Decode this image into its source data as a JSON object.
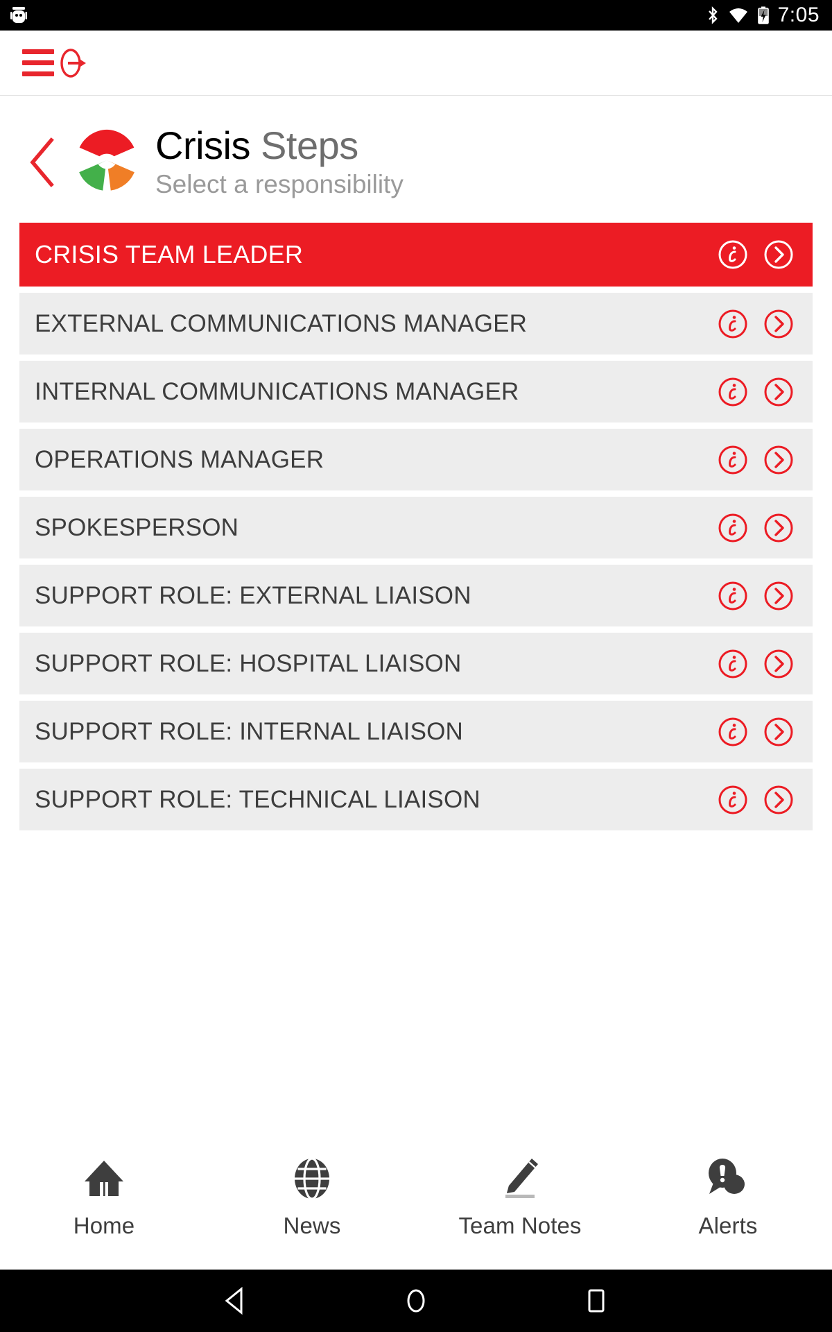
{
  "status_bar": {
    "time": "7:05",
    "icons": [
      "android-robot-icon",
      "bluetooth-icon",
      "wifi-icon",
      "battery-charging-icon"
    ]
  },
  "app_bar": {
    "menu_icon": "hamburger-menu-icon",
    "logout_icon": "logout-icon"
  },
  "header": {
    "back_icon": "back-chevron-icon",
    "logo_icon": "crisis-steps-logo",
    "title_primary": "Crisis",
    "title_secondary": "Steps",
    "subtitle": "Select a responsibility"
  },
  "colors": {
    "brand_red": "#ec1c24",
    "row_gray": "#ededed",
    "row_text": "#3d3d3d",
    "logo_green": "#43b04a",
    "logo_orange": "#f07e26",
    "title_secondary": "#6e6e6e",
    "subtitle": "#9a9a9a"
  },
  "roles": [
    {
      "label": "CRISIS TEAM LEADER",
      "selected": true,
      "info_icon": "info-circle-icon",
      "chevron_icon": "chevron-right-circle-icon"
    },
    {
      "label": "EXTERNAL COMMUNICATIONS MANAGER",
      "selected": false,
      "info_icon": "info-circle-icon",
      "chevron_icon": "chevron-right-circle-icon"
    },
    {
      "label": "INTERNAL COMMUNICATIONS MANAGER",
      "selected": false,
      "info_icon": "info-circle-icon",
      "chevron_icon": "chevron-right-circle-icon"
    },
    {
      "label": "OPERATIONS MANAGER",
      "selected": false,
      "info_icon": "info-circle-icon",
      "chevron_icon": "chevron-right-circle-icon"
    },
    {
      "label": "SPOKESPERSON",
      "selected": false,
      "info_icon": "info-circle-icon",
      "chevron_icon": "chevron-right-circle-icon"
    },
    {
      "label": "SUPPORT ROLE: EXTERNAL LIAISON",
      "selected": false,
      "info_icon": "info-circle-icon",
      "chevron_icon": "chevron-right-circle-icon"
    },
    {
      "label": "SUPPORT ROLE: HOSPITAL LIAISON",
      "selected": false,
      "info_icon": "info-circle-icon",
      "chevron_icon": "chevron-right-circle-icon"
    },
    {
      "label": "SUPPORT ROLE: INTERNAL LIAISON",
      "selected": false,
      "info_icon": "info-circle-icon",
      "chevron_icon": "chevron-right-circle-icon"
    },
    {
      "label": "SUPPORT ROLE: TECHNICAL LIAISON",
      "selected": false,
      "info_icon": "info-circle-icon",
      "chevron_icon": "chevron-right-circle-icon"
    }
  ],
  "tab_bar": [
    {
      "label": "Home",
      "icon": "home-icon"
    },
    {
      "label": "News",
      "icon": "globe-icon"
    },
    {
      "label": "Team Notes",
      "icon": "pencil-icon"
    },
    {
      "label": "Alerts",
      "icon": "alert-speech-bubble-icon"
    }
  ],
  "nav_bar": [
    {
      "icon": "android-back-icon"
    },
    {
      "icon": "android-home-icon"
    },
    {
      "icon": "android-recents-icon"
    }
  ]
}
